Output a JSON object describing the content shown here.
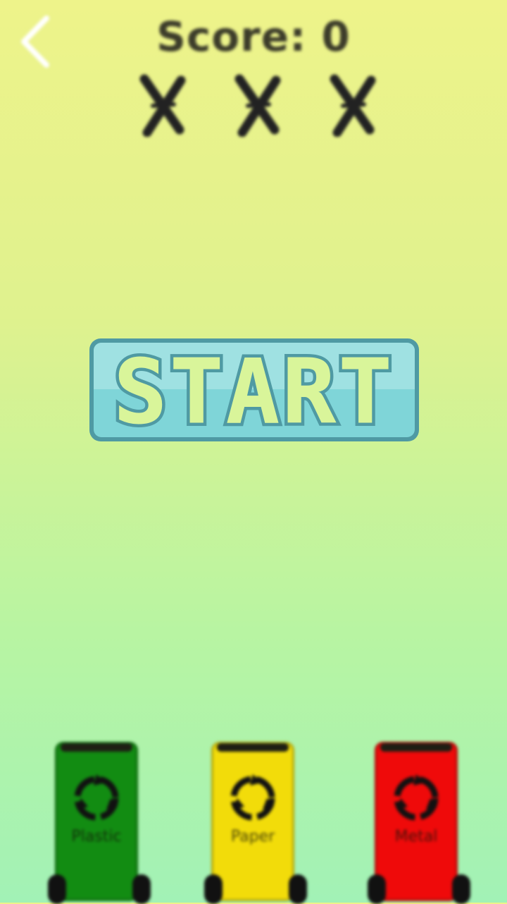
{
  "hud": {
    "score_text": "Score: 0",
    "lives": [
      {
        "state": "lost"
      },
      {
        "state": "lost"
      },
      {
        "state": "lost"
      }
    ]
  },
  "start_button": {
    "label": "START",
    "face_color": "#7fd5d8",
    "outline_color": "#4f9aa3",
    "text_color": "#d9f59a"
  },
  "bins": [
    {
      "label": "Plastic",
      "color": "#128c12",
      "icon": "recycle-icon"
    },
    {
      "label": "Paper",
      "color": "#f2dc0a",
      "icon": "recycle-icon"
    },
    {
      "label": "Metal",
      "color": "#ef0a0a",
      "icon": "recycle-icon"
    }
  ],
  "back_icon": "chevron-left-icon"
}
